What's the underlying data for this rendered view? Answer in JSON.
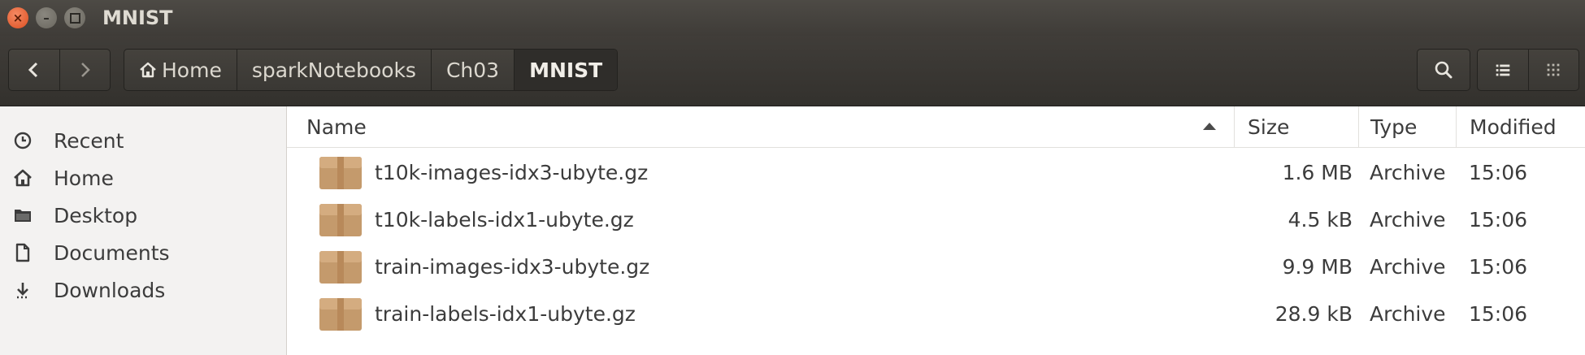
{
  "window": {
    "title": "MNIST"
  },
  "breadcrumbs": [
    "Home",
    "sparkNotebooks",
    "Ch03",
    "MNIST"
  ],
  "sidebar": {
    "items": [
      {
        "label": "Recent",
        "icon": "clock-icon"
      },
      {
        "label": "Home",
        "icon": "home-icon"
      },
      {
        "label": "Desktop",
        "icon": "folder-icon"
      },
      {
        "label": "Documents",
        "icon": "document-icon"
      },
      {
        "label": "Downloads",
        "icon": "download-icon"
      }
    ]
  },
  "columns": {
    "name": "Name",
    "size": "Size",
    "type": "Type",
    "modified": "Modified"
  },
  "files": [
    {
      "name": "t10k-images-idx3-ubyte.gz",
      "size": "1.6 MB",
      "type": "Archive",
      "modified": "15:06"
    },
    {
      "name": "t10k-labels-idx1-ubyte.gz",
      "size": "4.5 kB",
      "type": "Archive",
      "modified": "15:06"
    },
    {
      "name": "train-images-idx3-ubyte.gz",
      "size": "9.9 MB",
      "type": "Archive",
      "modified": "15:06"
    },
    {
      "name": "train-labels-idx1-ubyte.gz",
      "size": "28.9 kB",
      "type": "Archive",
      "modified": "15:06"
    }
  ],
  "colors": {
    "titlebar": "#3f3c38",
    "close": "#e25a2b",
    "archive_icon": "#c49a6c"
  }
}
